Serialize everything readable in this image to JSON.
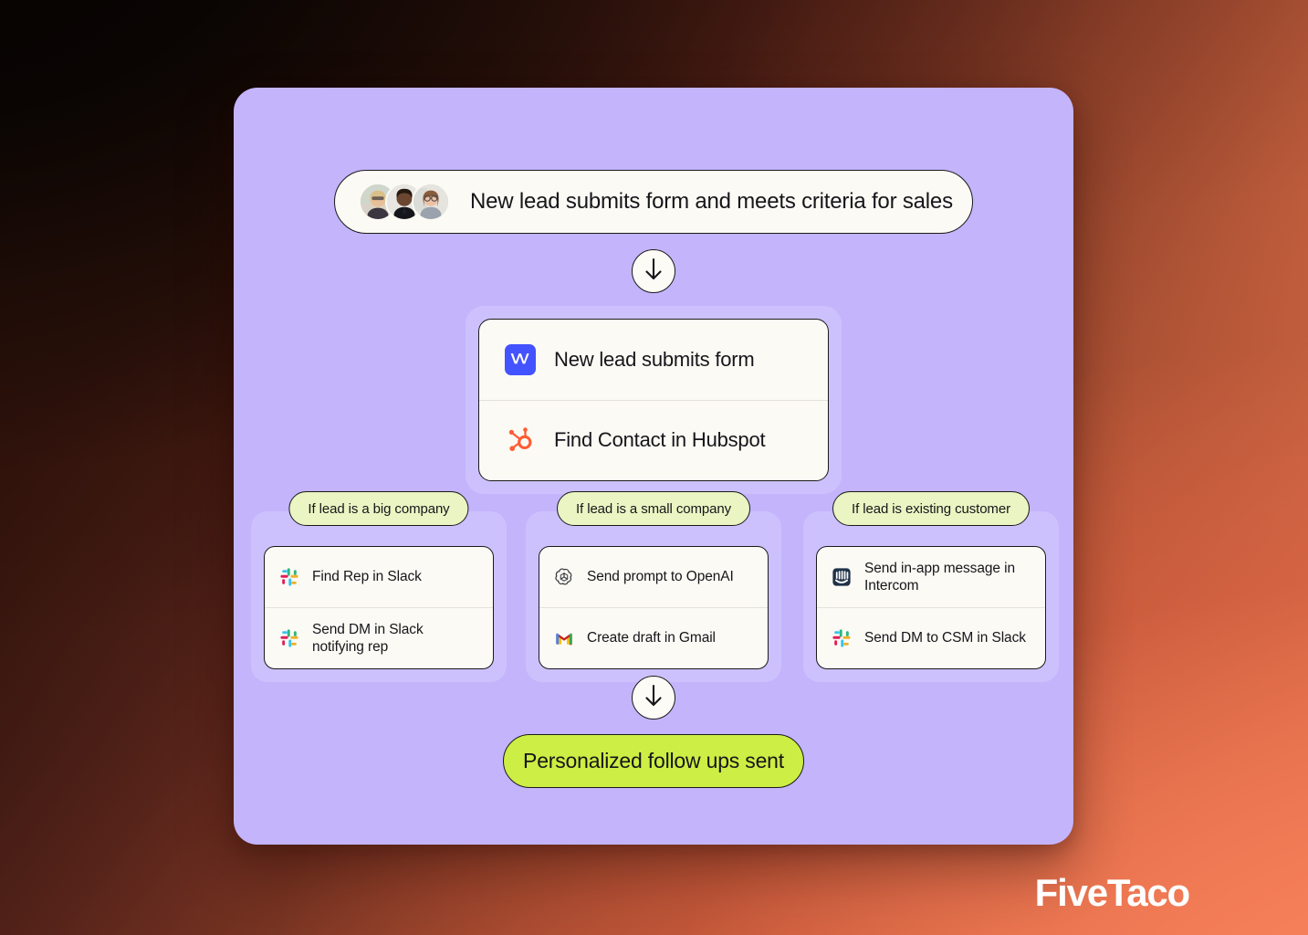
{
  "brand": {
    "name": "FiveTaco"
  },
  "colors": {
    "board_purple": "#C3B4FC",
    "panel_purple": "#CDC1FD",
    "card_cream": "#FBFAF4",
    "chip_green": "#EAF5C3",
    "result_green": "#CDEE44",
    "ink": "#16161a",
    "webflow_blue": "#4353FF",
    "hubspot_orange": "#FF5C35",
    "intercom_navy": "#1F3247",
    "bg_dark": "#120805",
    "bg_coral": "#F07A54"
  },
  "trigger": {
    "label": "New lead submits form and meets criteria for sales",
    "avatars": [
      {
        "name": "avatar-person-1"
      },
      {
        "name": "avatar-person-2"
      },
      {
        "name": "avatar-person-3"
      }
    ]
  },
  "arrows": [
    {
      "name": "arrow-down-1",
      "icon": "arrow-down-icon"
    },
    {
      "name": "arrow-down-2",
      "icon": "arrow-down-icon"
    }
  ],
  "main_card": {
    "rows": [
      {
        "icon": "webflow-icon",
        "label": "New lead submits form"
      },
      {
        "icon": "hubspot-icon",
        "label": "Find Contact in Hubspot"
      }
    ]
  },
  "branches": [
    {
      "chip": "If lead is a big company",
      "rows": [
        {
          "icon": "slack-icon",
          "label": "Find Rep in Slack"
        },
        {
          "icon": "slack-icon",
          "label": "Send DM in Slack notifying rep"
        }
      ]
    },
    {
      "chip": "If lead is a small company",
      "rows": [
        {
          "icon": "openai-icon",
          "label": "Send prompt to OpenAI"
        },
        {
          "icon": "gmail-icon",
          "label": "Create draft in Gmail"
        }
      ]
    },
    {
      "chip": "If lead is existing customer",
      "rows": [
        {
          "icon": "intercom-icon",
          "label": "Send in-app message in Intercom"
        },
        {
          "icon": "slack-icon",
          "label": "Send DM to CSM in Slack"
        }
      ]
    }
  ],
  "result": {
    "label": "Personalized follow ups sent"
  }
}
